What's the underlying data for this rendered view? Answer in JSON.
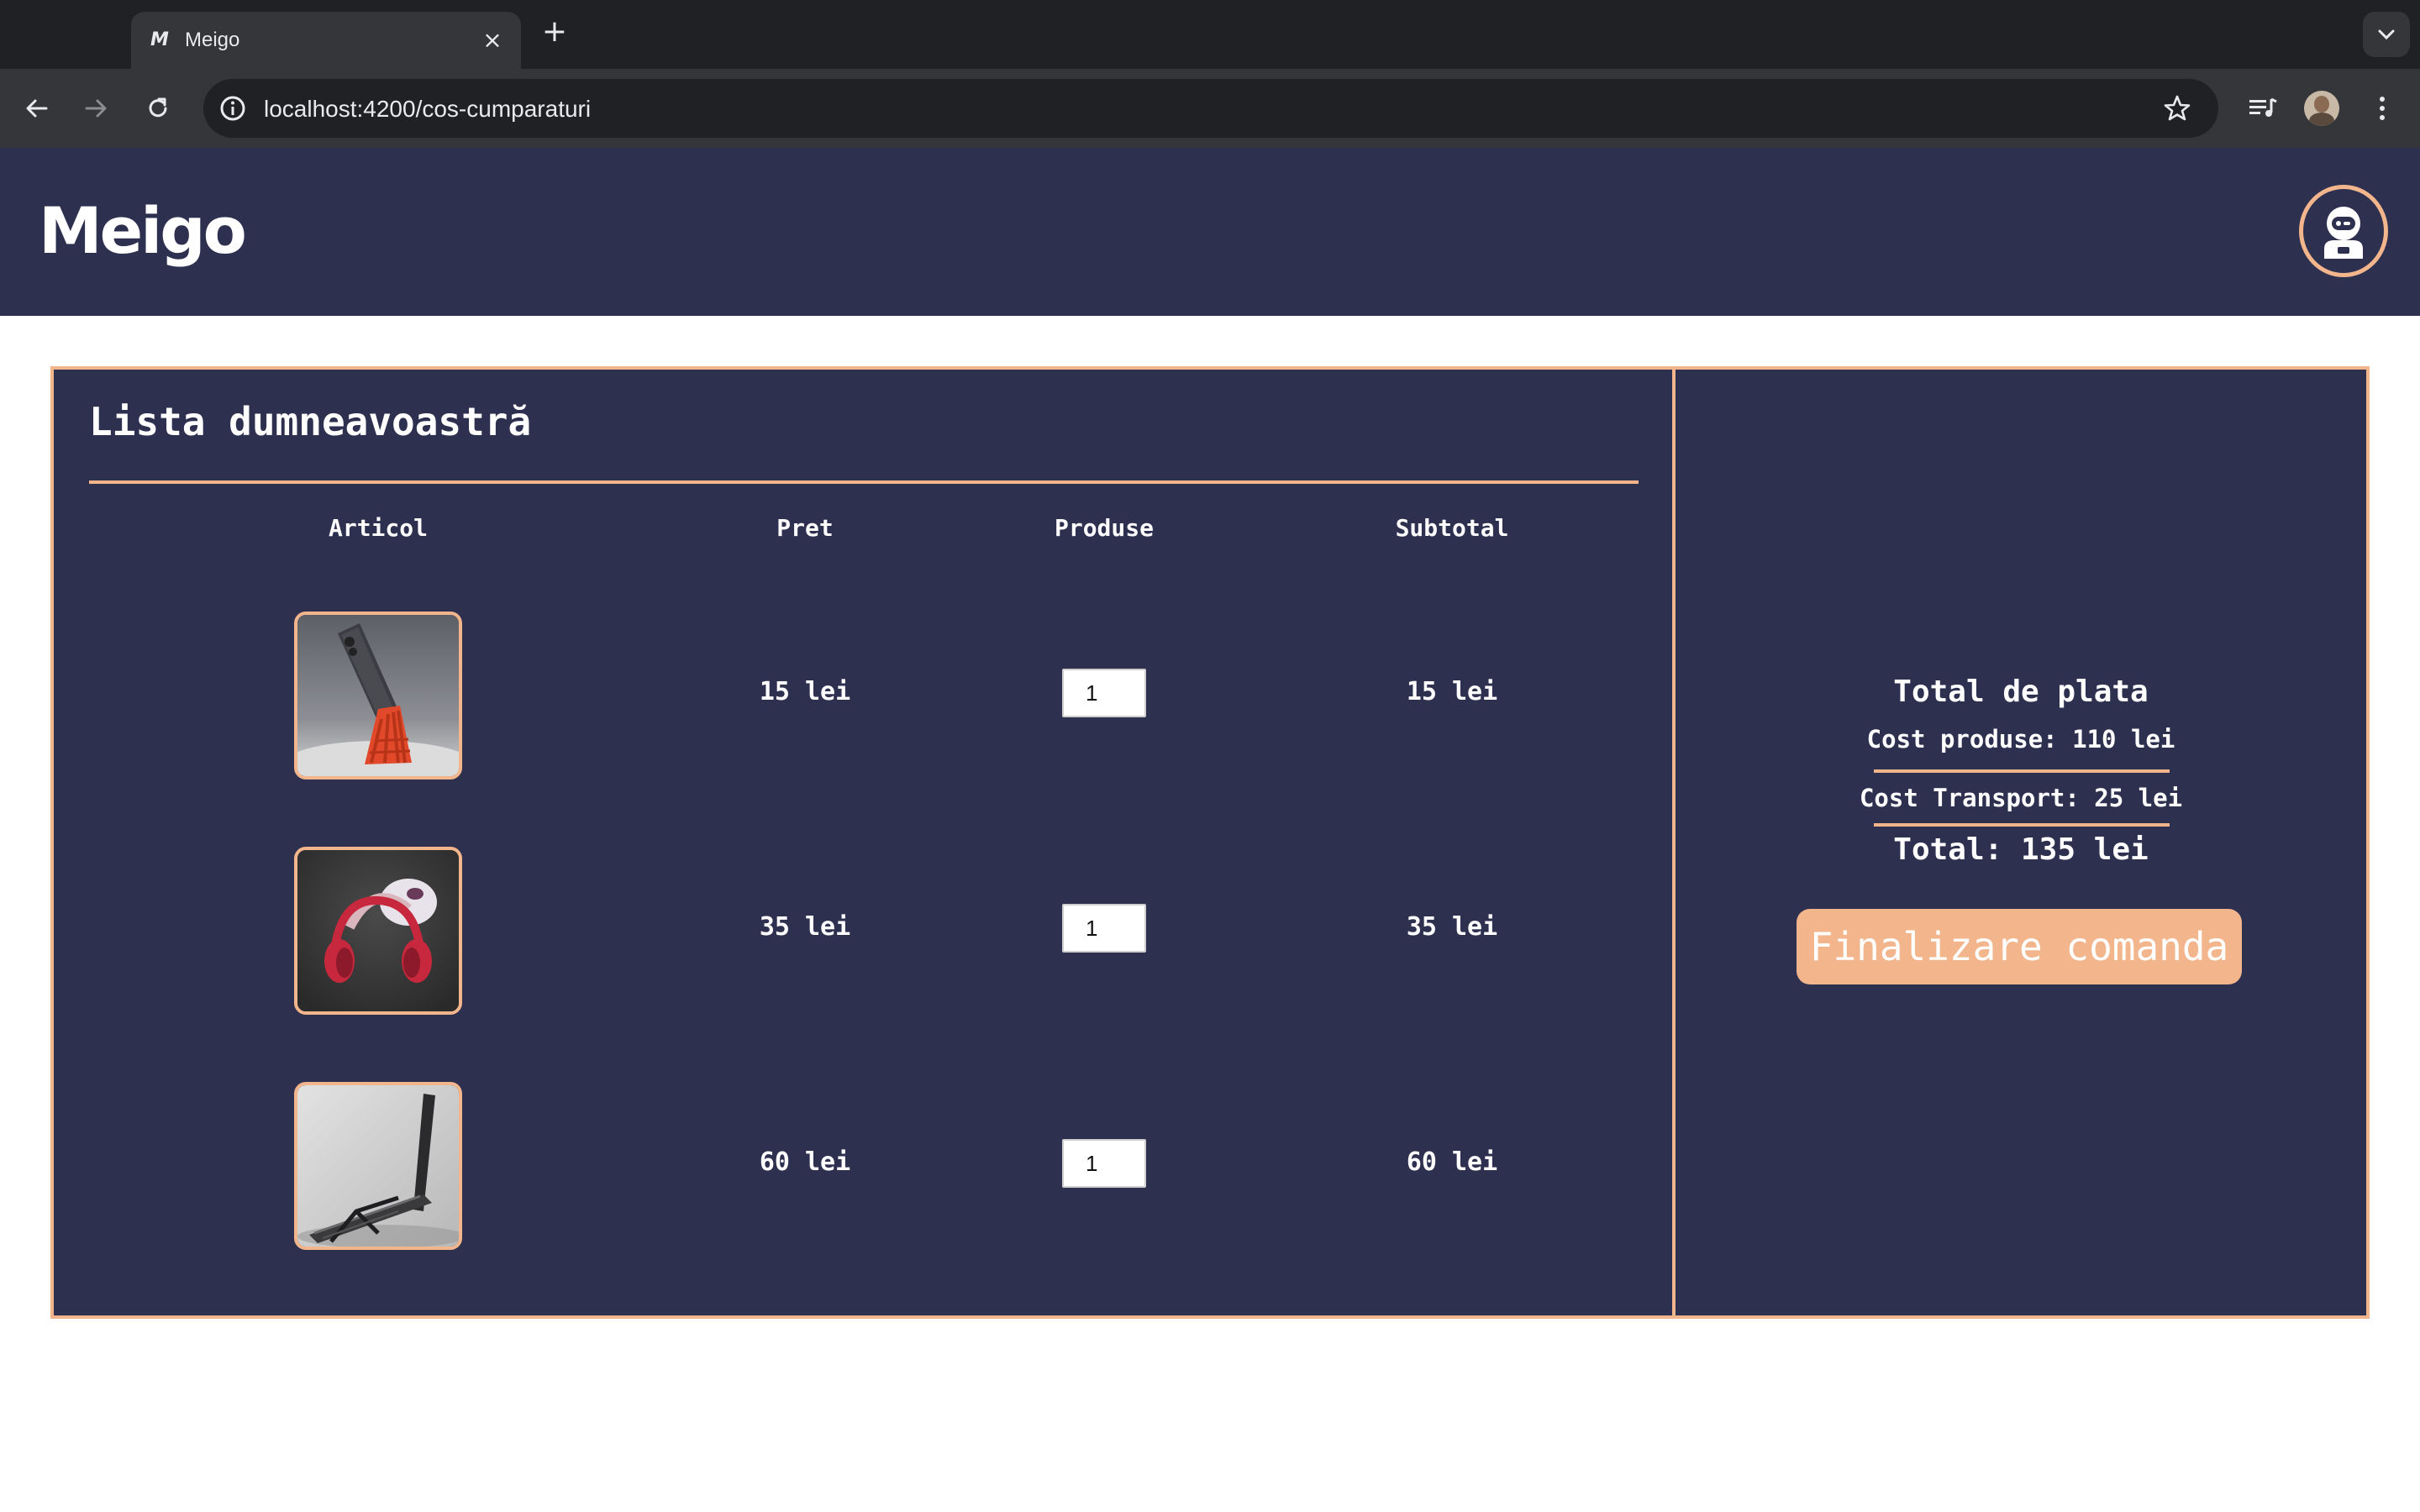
{
  "browser": {
    "tab_title": "Meigo",
    "tab_favicon": "M",
    "url": "localhost:4200/cos-cumparaturi"
  },
  "header": {
    "logo": "Meigo"
  },
  "cart": {
    "title": "Lista dumneavoastră",
    "columns": {
      "item": "Articol",
      "price": "Pret",
      "quantity": "Produse",
      "subtotal": "Subtotal"
    },
    "items": [
      {
        "product": "phone stand",
        "price": "15 lei",
        "quantity": "1",
        "subtotal": "15 lei"
      },
      {
        "product": "headphone holder",
        "price": "35 lei",
        "quantity": "1",
        "subtotal": "35 lei"
      },
      {
        "product": "laptop stand",
        "price": "60 lei",
        "quantity": "1",
        "subtotal": "60 lei"
      }
    ]
  },
  "summary": {
    "title": "Total de plata",
    "products_cost": "Cost produse: 110 lei",
    "transport_cost": "Cost Transport: 25 lei",
    "total": "Total: 135 lei",
    "checkout_label": "Finalizare comanda"
  },
  "colors": {
    "panel_bg": "#2e3050",
    "accent": "#f2b58c",
    "text": "#ffffff"
  }
}
